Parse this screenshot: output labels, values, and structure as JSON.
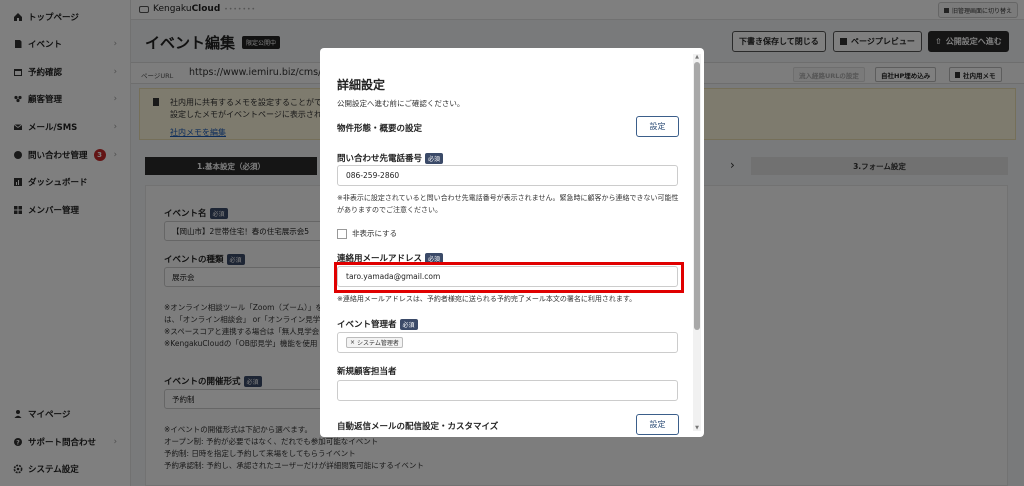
{
  "sidebar": {
    "items": [
      {
        "label": "トップページ",
        "icon": "home-icon",
        "chevron": ""
      },
      {
        "label": "イベント",
        "icon": "document-icon",
        "chevron": "›"
      },
      {
        "label": "予約確認",
        "icon": "calendar-icon",
        "chevron": "›"
      },
      {
        "label": "顧客管理",
        "icon": "users-icon",
        "chevron": "›"
      },
      {
        "label": "メール/SMS",
        "icon": "mail-icon",
        "chevron": "›"
      },
      {
        "label": "問い合わせ管理",
        "icon": "chat-icon",
        "chevron": "›",
        "badge": "3"
      },
      {
        "label": "ダッシュボード",
        "icon": "chart-icon",
        "chevron": ""
      },
      {
        "label": "メンバー管理",
        "icon": "grid-icon",
        "chevron": ""
      }
    ],
    "bottom_items": [
      {
        "label": "マイページ",
        "icon": "person-icon",
        "chevron": ""
      },
      {
        "label": "サポート問合わせ",
        "icon": "help-icon",
        "chevron": "›"
      },
      {
        "label": "システム設定",
        "icon": "gear-icon",
        "chevron": ""
      }
    ]
  },
  "topbar": {
    "logo_prefix": "Kengaku",
    "logo_bold": "Cloud",
    "logo_dots": "•••••••",
    "switch_label": "旧管理画面に切り替え"
  },
  "header": {
    "title": "イベント編集",
    "badge": "限定公開中",
    "save_close": "下書き保存して閉じる",
    "preview": "ページプレビュー",
    "publish": "公開設定へ進む"
  },
  "url_row": {
    "label": "ページURL",
    "url": "https://www.iemiru.biz/cms/yo",
    "embed_url": "流入経路URLの設定",
    "embed_hp": "自社HP埋め込み",
    "memo": "社内用メモ"
  },
  "memo_box": {
    "line1": "社内用に共有するメモを設定することができ",
    "line2": "設定したメモがイベントページに表示されるこ",
    "link": "社内メモを編集"
  },
  "steps": {
    "step1": "1.基本設定（必須）",
    "step3": "3.フォーム設定"
  },
  "form": {
    "event_name_label": "イベント名",
    "event_name_value": "【岡山市】2世帯住宅！春の住宅展示会5",
    "event_type_label": "イベントの種類",
    "event_type_value": "展示会",
    "type_notes": [
      "※オンライン相談ツール「Zoom（ズーム）」を",
      "は、「オンライン相談会」 or「オンライン見学",
      "※スペースコアと連携する場合は「無人見学会",
      "※KengakuCloudの「OB邸見学」機能を使用"
    ],
    "format_label": "イベントの開催形式",
    "format_value": "予約制",
    "format_notes": [
      "※イベントの開催形式は下記から選べます。",
      "オープン制: 予約が必要ではなく、だれでも参加可能なイベント",
      "予約制: 日時を指定し予約して来場をしてもらうイベント",
      "予約承認制: 予約し、承認されたユーザーだけが詳細閲覧可能にするイベント"
    ],
    "required": "必須"
  },
  "modal": {
    "title": "詳細設定",
    "subtitle": "公開設定へ進む前にご確認ください。",
    "property_label": "物件形態・概要の設定",
    "settings_button": "設定",
    "phone_label": "問い合わせ先電話番号",
    "phone_value": "086-259-2860",
    "phone_note": "※非表示に設定されていると問い合わせ先電話番号が表示されません。緊急時に顧客から連絡できない可能性がありますのでご注意ください。",
    "hide_label": "非表示にする",
    "email_label": "連絡用メールアドレス",
    "email_value": "taro.yamada@gmail.com",
    "email_note": "※連絡用メールアドレスは、予約者様宛に送られる予約完了メール本文の署名に利用されます。",
    "manager_label": "イベント管理者",
    "manager_tag": "システム管理者",
    "manager_tag_x": "×",
    "new_customer_label": "新規顧客担当者",
    "auto_reply_label": "自動返信メールの配信設定・カスタマイズ",
    "required": "必須"
  }
}
